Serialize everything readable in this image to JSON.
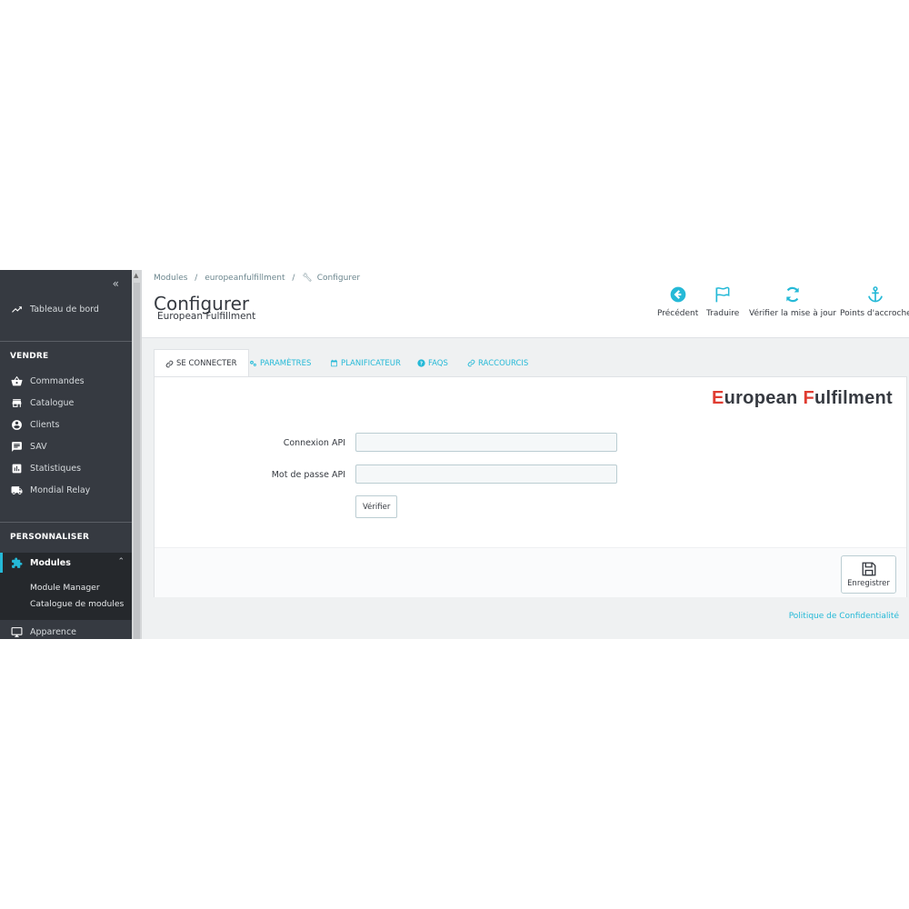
{
  "sidebar": {
    "collapse_icon": "double-chevron-left-icon",
    "dashboard": {
      "label": "Tableau de bord",
      "icon": "trending-up-icon"
    },
    "sections": [
      {
        "title": "VENDRE"
      },
      {
        "title": "PERSONNALISER"
      }
    ],
    "sell_items": [
      {
        "label": "Commandes",
        "icon": "shopping-basket-icon"
      },
      {
        "label": "Catalogue",
        "icon": "store-icon"
      },
      {
        "label": "Clients",
        "icon": "account-circle-icon"
      },
      {
        "label": "SAV",
        "icon": "chat-icon"
      },
      {
        "label": "Statistiques",
        "icon": "bar-chart-icon"
      },
      {
        "label": "Mondial Relay",
        "icon": "truck-icon"
      }
    ],
    "modules": {
      "label": "Modules",
      "icon": "puzzle-icon",
      "expanded": true
    },
    "submenu": [
      {
        "label": "Module Manager"
      },
      {
        "label": "Catalogue de modules"
      }
    ],
    "appearance": {
      "label": "Apparence",
      "icon": "desktop-icon"
    }
  },
  "header": {
    "breadcrumb": [
      "Modules",
      "/",
      "europeanfulfillment",
      "/",
      "Configurer"
    ],
    "title": "Configurer",
    "subtitle": "European Fulfillment",
    "toolbar": [
      {
        "label": "Précédent",
        "icon": "arrow-circle-left-icon"
      },
      {
        "label": "Traduire",
        "icon": "flag-icon"
      },
      {
        "label": "Vérifier la mise à jour",
        "icon": "refresh-icon"
      },
      {
        "label": "Points d'accroche",
        "icon": "anchor-icon"
      }
    ]
  },
  "tabs": [
    {
      "label": "SE CONNECTER",
      "icon": "link-icon",
      "active": true
    },
    {
      "label": "PARAMÈTRES",
      "icon": "cogs-icon"
    },
    {
      "label": "PLANIFICATEUR",
      "icon": "calendar-icon"
    },
    {
      "label": "FAQS",
      "icon": "question-circle-icon"
    },
    {
      "label": "RACCOURCIS",
      "icon": "link-icon"
    }
  ],
  "panel": {
    "logo": {
      "part1_accent": "E",
      "part1_rest": "uropean ",
      "part2_accent": "F",
      "part2_rest": "ulfilment"
    },
    "fields": [
      {
        "label": "Connexion API",
        "value": "",
        "placeholder": ""
      },
      {
        "label": "Mot de passe API",
        "value": "",
        "placeholder": ""
      }
    ],
    "verify_label": "Vérifier",
    "save_label": "Enregistrer",
    "save_icon": "floppy-disk-icon"
  },
  "footer": {
    "privacy_link": "Politique de Confidentialité"
  },
  "colors": {
    "sidebar_bg": "#363a41",
    "accent": "#25b9d7",
    "logo_red": "#e03c31",
    "page_bg": "#eff1f2"
  }
}
